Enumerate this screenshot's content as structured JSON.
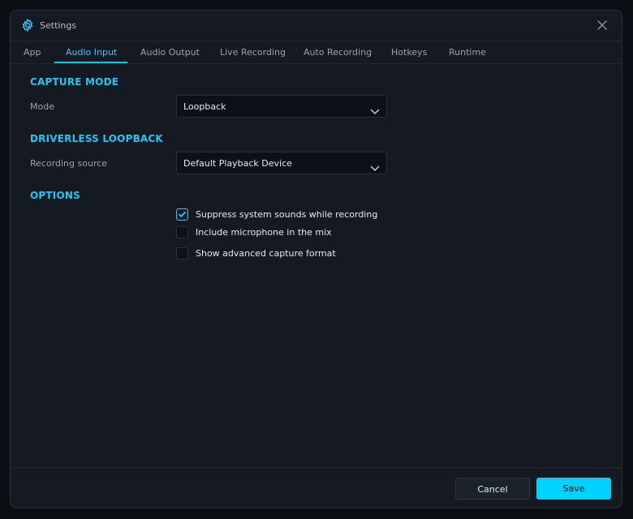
{
  "window": {
    "title": "Settings",
    "icon": "gear-icon",
    "close_icon": "close-icon"
  },
  "tabs": [
    {
      "label": "App",
      "active": false
    },
    {
      "label": "Audio Input",
      "active": true
    },
    {
      "label": "Audio Output",
      "active": false
    },
    {
      "label": "Live Recording",
      "active": false
    },
    {
      "label": "Auto Recording",
      "active": false
    },
    {
      "label": "Hotkeys",
      "active": false
    },
    {
      "label": "Runtime",
      "active": false
    }
  ],
  "capture_mode": {
    "section_title": "CAPTURE MODE",
    "mode_label": "Mode",
    "mode_value": "Loopback"
  },
  "driverless_loopback": {
    "section_title": "DRIVERLESS LOOPBACK",
    "source_label": "Recording source",
    "source_value": "Default Playback Device"
  },
  "options": {
    "section_title": "OPTIONS",
    "items": [
      {
        "label": "Suppress system sounds while recording",
        "checked": true
      },
      {
        "label": "Include microphone in the mix",
        "checked": false
      },
      {
        "label": "Show advanced capture format",
        "checked": false
      }
    ]
  },
  "footer": {
    "cancel_label": "Cancel",
    "save_label": "Save"
  },
  "colors": {
    "accent": "#00d2ff",
    "section_title": "#27c6f0",
    "background": "#151a22"
  }
}
